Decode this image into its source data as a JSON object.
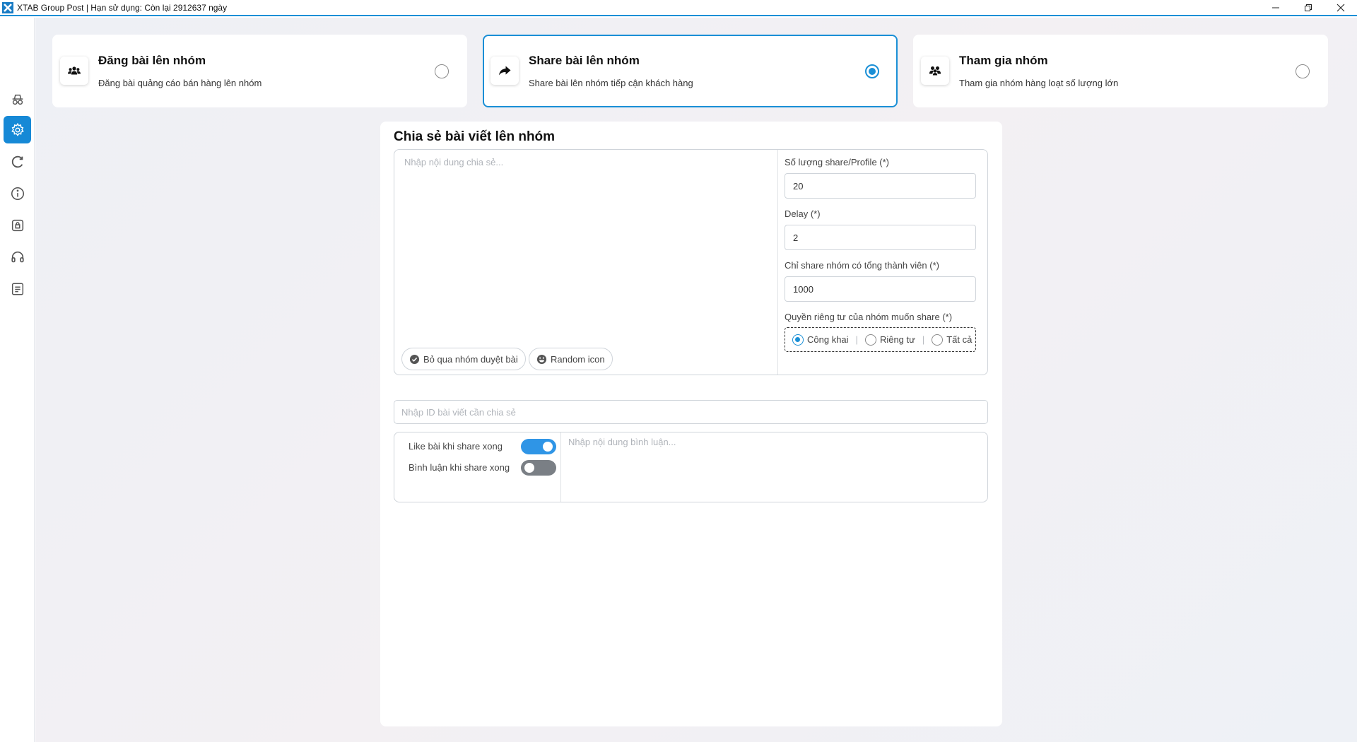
{
  "window": {
    "title": "XTAB Group Post | Hạn sử dụng: Còn lại 2912637 ngày",
    "controls": [
      "minimize-icon",
      "restore-icon",
      "close-icon"
    ]
  },
  "sidebar": {
    "items": [
      {
        "icon": "incognito-icon",
        "active": false
      },
      {
        "icon": "gear-icon",
        "active": true
      },
      {
        "icon": "refresh-icon",
        "active": false
      },
      {
        "icon": "info-icon",
        "active": false
      },
      {
        "icon": "lock-icon",
        "active": false
      },
      {
        "icon": "headset-icon",
        "active": false
      },
      {
        "icon": "document-icon",
        "active": false
      }
    ],
    "active_color": "#1689d6"
  },
  "modes": [
    {
      "title": "Đăng bài lên nhóm",
      "desc": "Đăng bài quảng cáo bán hàng lên nhóm",
      "icon": "users-icon",
      "selected": false
    },
    {
      "title": "Share bài lên nhóm",
      "desc": "Share bài lên nhóm tiếp cận khách hàng",
      "icon": "share-arrow-icon",
      "selected": true
    },
    {
      "title": "Tham gia nhóm",
      "desc": "Tham gia nhóm hàng loạt số lượng lớn",
      "icon": "user-group-icon",
      "selected": false
    }
  ],
  "panel": {
    "title": "Chia sẻ bài viết lên nhóm",
    "content_placeholder": "Nhập nội dung chia sẻ...",
    "chips": {
      "skip_review": "Bỏ qua nhóm duyệt bài",
      "random_icon": "Random icon"
    },
    "fields": {
      "share_count_label": "Số lượng share/Profile (*)",
      "share_count_value": "20",
      "delay_label": "Delay (*)",
      "delay_value": "2",
      "min_members_label": "Chỉ share nhóm có tổng thành viên (*)",
      "min_members_value": "1000",
      "privacy_label": "Quyền riêng tư của nhóm muốn share (*)"
    },
    "privacy_options": [
      {
        "label": "Công khai",
        "selected": true
      },
      {
        "label": "Riêng tư",
        "selected": false
      },
      {
        "label": "Tất cả",
        "selected": false
      }
    ],
    "post_id_placeholder": "Nhập ID bài viết cần chia sẻ",
    "after_share": {
      "like_label": "Like bài khi share xong",
      "like_on": true,
      "comment_label": "Bình luận khi share xong",
      "comment_on": false,
      "comment_placeholder": "Nhập nội dung bình luận..."
    }
  },
  "accent_color": "#1a8fd6"
}
